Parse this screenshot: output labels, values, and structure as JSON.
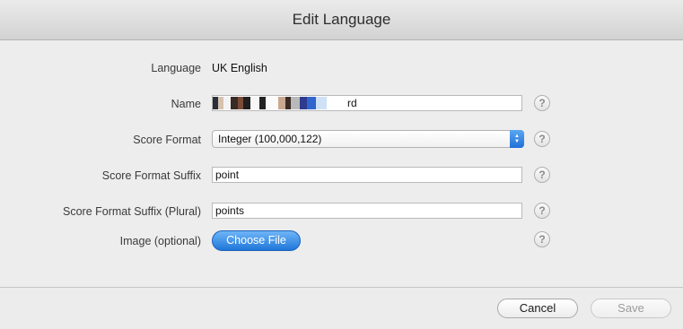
{
  "window": {
    "title": "Edit Language"
  },
  "form": {
    "language": {
      "label": "Language",
      "value": "UK English"
    },
    "name": {
      "label": "Name",
      "value": "rd"
    },
    "score_format": {
      "label": "Score Format",
      "value": "Integer (100,000,122)"
    },
    "suffix": {
      "label": "Score Format Suffix",
      "value": "point"
    },
    "suffix_plural": {
      "label": "Score Format Suffix (Plural)",
      "value": "points"
    },
    "image": {
      "label": "Image (optional)",
      "button": "Choose File"
    },
    "help_glyph": "?"
  },
  "footer": {
    "cancel": "Cancel",
    "save": "Save"
  },
  "colors": {
    "accent": "#1f76d9",
    "background": "#ececec"
  }
}
